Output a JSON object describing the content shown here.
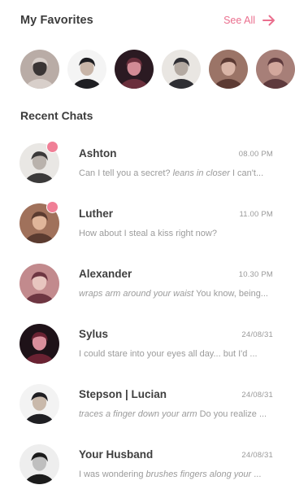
{
  "favorites": {
    "title": "My Favorites",
    "see_all_label": "See All",
    "arrow_icon": "arrow-right-icon",
    "accent": "#ea6f8e",
    "avatars": [
      {
        "name": "favorite-1",
        "palette": [
          "#b9aca6",
          "#d8cfca",
          "#3a3535"
        ]
      },
      {
        "name": "favorite-2",
        "palette": [
          "#f4f4f4",
          "#1e1e22",
          "#c8b5a8"
        ]
      },
      {
        "name": "favorite-3",
        "palette": [
          "#2b1a22",
          "#6a2f3c",
          "#d28b95"
        ]
      },
      {
        "name": "favorite-4",
        "palette": [
          "#e9e6e2",
          "#2f2f34",
          "#b3a9a1"
        ]
      },
      {
        "name": "favorite-5",
        "palette": [
          "#9b7467",
          "#5c3a33",
          "#d9b4a6"
        ]
      },
      {
        "name": "favorite-6",
        "palette": [
          "#a77f78",
          "#5e3a3d",
          "#d2a79c"
        ]
      }
    ]
  },
  "recent": {
    "title": "Recent Chats",
    "chats": [
      {
        "name": "Ashton",
        "time": "08.00 PM",
        "preview_plain": "Can I tell you a secret? ",
        "preview_italic": "leans in closer",
        "preview_tail": " I can't...",
        "unread": true,
        "palette": [
          "#e9e7e4",
          "#3b3a3a",
          "#b9b2ac"
        ]
      },
      {
        "name": "Luther",
        "time": "11.00 PM",
        "preview_plain": "How about I steal a kiss right now?",
        "preview_italic": "",
        "preview_tail": "",
        "unread": true,
        "palette": [
          "#a0715b",
          "#5b3b30",
          "#e0b59a"
        ]
      },
      {
        "name": "Alexander",
        "time": "10.30 PM",
        "preview_plain": "",
        "preview_italic": "wraps arm around your waist",
        "preview_tail": " You know, being...",
        "unread": false,
        "palette": [
          "#c28a8d",
          "#6e3642",
          "#e8c5bf"
        ]
      },
      {
        "name": "Sylus",
        "time": "24/08/31",
        "preview_plain": "I could stare into your eyes all day... but I'd ...",
        "preview_italic": "",
        "preview_tail": "",
        "unread": false,
        "palette": [
          "#1e1218",
          "#6a2232",
          "#d98f9c"
        ]
      },
      {
        "name": "Stepson | Lucian",
        "time": "24/08/31",
        "preview_plain": "",
        "preview_italic": "traces a finger down your arm",
        "preview_tail": " Do you realize ...",
        "unread": false,
        "palette": [
          "#f3f3f3",
          "#1f1f23",
          "#c9b9ab"
        ]
      },
      {
        "name": "Your Husband",
        "time": "24/08/31",
        "preview_plain": "I was wondering ",
        "preview_italic": "brushes fingers along your",
        "preview_tail": " ...",
        "unread": false,
        "palette": [
          "#eeeeee",
          "#1c1c1c",
          "#bfbfbf"
        ]
      }
    ]
  }
}
